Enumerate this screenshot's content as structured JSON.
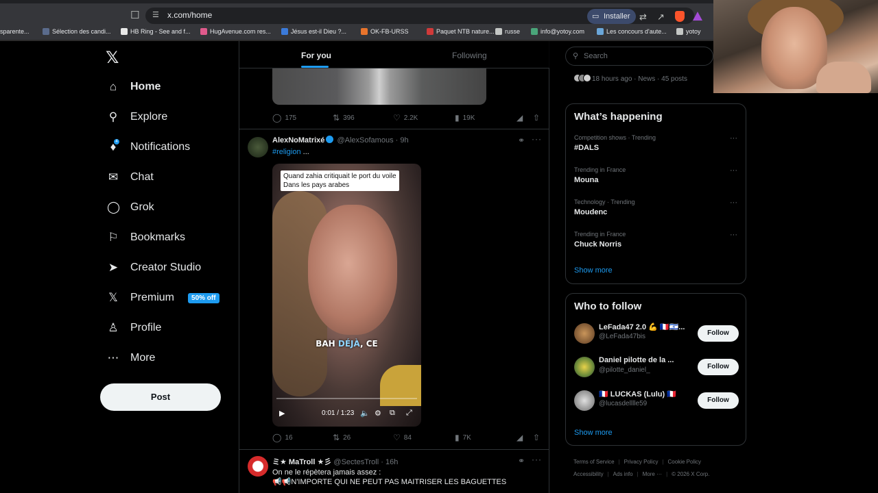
{
  "browser": {
    "url": "x.com/home",
    "install_label": "Installer",
    "bookmarks": [
      {
        "label": "sparente...",
        "color": "#ffffff"
      },
      {
        "label": "Sélection des candi...",
        "color": "#5a6b8c"
      },
      {
        "label": "HB Ring - See and f...",
        "color": "#e8e8e8"
      },
      {
        "label": "HugAvenue.com res...",
        "color": "#e05a8c"
      },
      {
        "label": "Jésus est-il Dieu ?...",
        "color": "#3b7ad9"
      },
      {
        "label": "OK-FB-URSS",
        "color": "#e8742c"
      },
      {
        "label": "Paquet NTB nature...",
        "color": "#d03a3a"
      },
      {
        "label": "russe",
        "color": "#c4c7c5"
      },
      {
        "label": "info@yotoy.com",
        "color": "#4aa57a"
      },
      {
        "label": "Les concours d'aute...",
        "color": "#6aa6d9"
      },
      {
        "label": "yotoy",
        "color": "#c4c7c5"
      }
    ]
  },
  "nav": {
    "items": [
      {
        "label": "Home",
        "icon": "home-icon"
      },
      {
        "label": "Explore",
        "icon": "search-icon"
      },
      {
        "label": "Notifications",
        "icon": "bell-icon",
        "badge": "4"
      },
      {
        "label": "Chat",
        "icon": "mail-icon"
      },
      {
        "label": "Grok",
        "icon": "grok-icon"
      },
      {
        "label": "Bookmarks",
        "icon": "bookmark-icon"
      },
      {
        "label": "Creator Studio",
        "icon": "rocket-icon"
      },
      {
        "label": "Premium",
        "icon": "x-icon",
        "promo": "50% off"
      },
      {
        "label": "Profile",
        "icon": "person-icon"
      },
      {
        "label": "More",
        "icon": "more-circle-icon"
      }
    ],
    "post_label": "Post"
  },
  "feed": {
    "tabs": [
      "For you",
      "Following"
    ],
    "prev_actions": {
      "replies": "175",
      "reposts": "396",
      "likes": "2.2K",
      "views": "19K"
    },
    "tweet1": {
      "name": "AlexNoMatrixé",
      "handle": "@AlexSofamous",
      "time": "· 9h",
      "hashtag": "#religion",
      "text_suffix": " ...",
      "video": {
        "caption_line1": "Quand zahia critiquait le port du voile",
        "caption_line2": "Dans les pays arabes",
        "subtitle_a": "BAH ",
        "subtitle_b": "DÉJÀ",
        "subtitle_c": ", CE",
        "time": "0:01 / 1:23"
      },
      "actions": {
        "replies": "16",
        "reposts": "26",
        "likes": "84",
        "views": "7K"
      }
    },
    "tweet2": {
      "name": "ミ★ MaTroll ★彡",
      "handle": "@SectesTroll",
      "time": "· 16h",
      "line1": "On ne le répètera jamais assez :",
      "line2": "📢📢N'IMPORTE QUI NE PEUT PAS MAITRISER LES BAGUETTES"
    }
  },
  "right": {
    "search_placeholder": "Search",
    "news_meta": "18 hours ago · News · 45 posts",
    "happening_title": "What’s happening",
    "trends": [
      {
        "meta": "Competition shows · Trending",
        "topic": "#DALS"
      },
      {
        "meta": "Trending in France",
        "topic": "Mouna"
      },
      {
        "meta": "Technology · Trending",
        "topic": "Moudenc"
      },
      {
        "meta": "Trending in France",
        "topic": "Chuck Norris"
      }
    ],
    "show_more": "Show more",
    "who_title": "Who to follow",
    "follow": [
      {
        "name": "LeFada47 2.0 💪 🇫🇷🇮🇱...",
        "handle": "@LeFada47bis"
      },
      {
        "name": "Daniel pilotte de la ...",
        "handle": "@pilotte_daniel_"
      },
      {
        "name": "🇫🇷 LUCKAS (Lulu) 🇫🇷",
        "handle": "@lucasdelllle59"
      }
    ],
    "follow_label": "Follow",
    "footer": [
      "Terms of Service",
      "Privacy Policy",
      "Cookie Policy",
      "Accessibility",
      "Ads info",
      "More ···",
      "© 2026 X Corp."
    ]
  }
}
